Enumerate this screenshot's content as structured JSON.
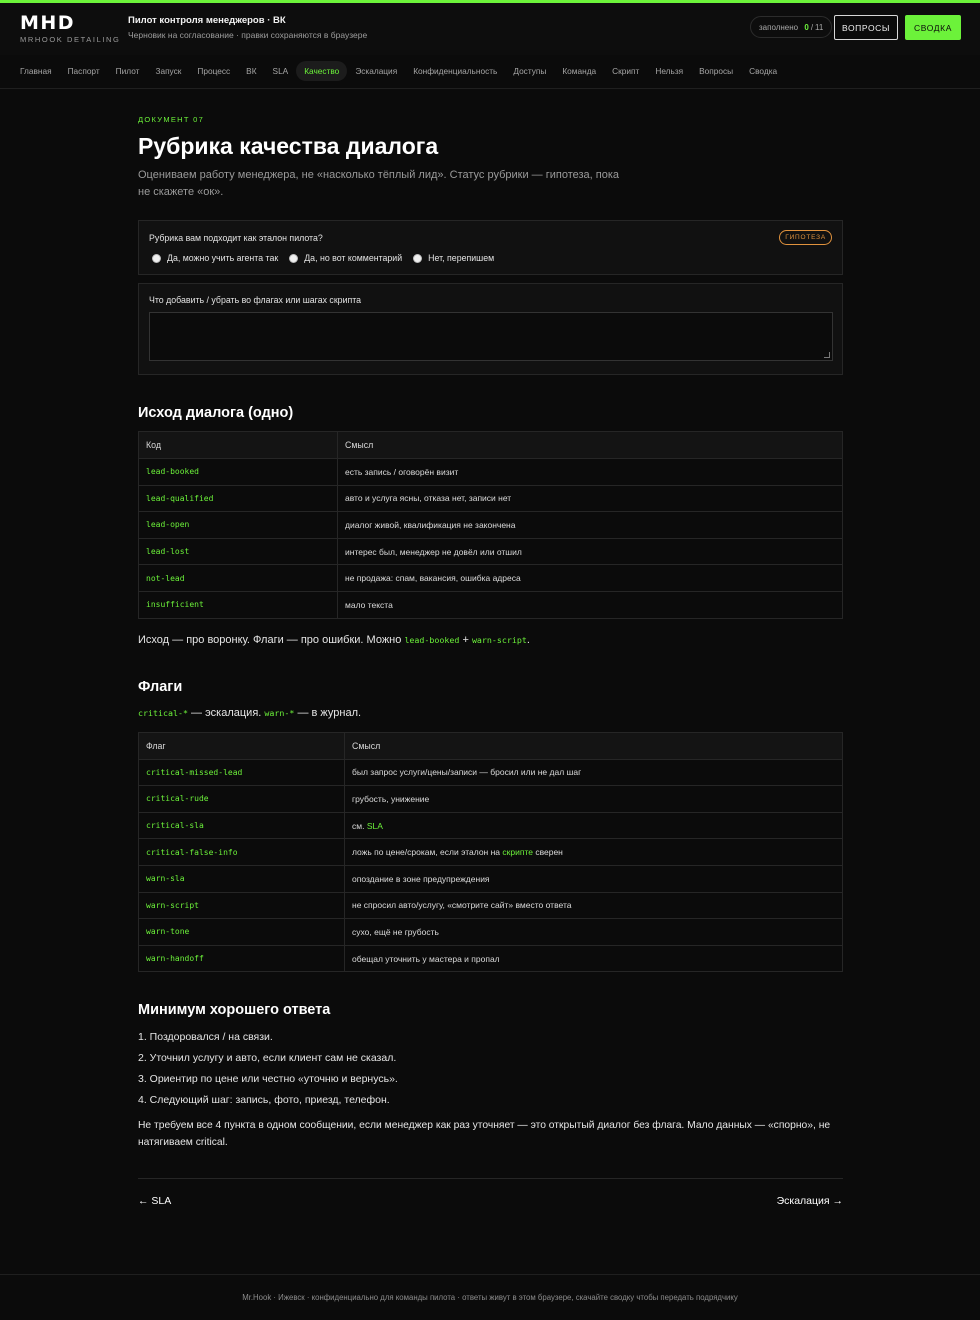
{
  "brand": {
    "mark": "MHD",
    "sub": "MRHOOK DETAILING"
  },
  "header": {
    "title": "Пилот контроля менеджеров · ВК",
    "subtitle": "Черновик на согласование · правки сохраняются в браузере",
    "progress": {
      "label": "заполнено",
      "filled": "0",
      "sep": "/",
      "total": "11"
    },
    "questions_label": "ВОПРОСЫ",
    "summary_label": "СВОДКА"
  },
  "nav": {
    "tabs": [
      "Главная",
      "Паспорт",
      "Пилот",
      "Запуск",
      "Процесс",
      "ВК",
      "SLA",
      "Качество",
      "Эскалация",
      "Конфиденциальность",
      "Доступы",
      "Команда",
      "Скрипт",
      "Нельзя",
      "Вопросы",
      "Сводка"
    ],
    "active_index": 7
  },
  "doc": {
    "label": "ДОКУМЕНТ 07",
    "title": "Рубрика качества диалога",
    "lead": "Оцениваем работу менеджера, не «насколько тёплый лид». Статус рубрики — гипотеза, пока не скажете «ок»."
  },
  "feedback": {
    "question": "Рубрика вам подходит как эталон пилота?",
    "badge": "ГИПОТЕЗА",
    "options": [
      "Да, можно учить агента так",
      "Да, но вот комментарий",
      "Нет, перепишем"
    ],
    "comment_label": "Что добавить / убрать во флагах или шагах скрипта",
    "comment_value": ""
  },
  "outcome": {
    "heading": "Исход диалога (одно)",
    "columns": [
      "Код",
      "Смысл"
    ],
    "rows": [
      [
        "lead-booked",
        "есть запись / оговорён визит"
      ],
      [
        "lead-qualified",
        "авто и услуга ясны, отказа нет, записи нет"
      ],
      [
        "lead-open",
        "диалог живой, квалификация не закончена"
      ],
      [
        "lead-lost",
        "интерес был, менеджер не довёл или отшил"
      ],
      [
        "not-lead",
        "не продажа: спам, вакансия, ошибка адреса"
      ],
      [
        "insufficient",
        "мало текста"
      ]
    ],
    "note": {
      "text": "Исход — про воронку. Флаги — про ошибки. Можно ",
      "code1": "lead-booked",
      "plus": " + ",
      "code2": "warn-script",
      "end": "."
    }
  },
  "flags": {
    "heading": "Флаги",
    "intro": {
      "code1": "critical-*",
      "mid": " — эскалация. ",
      "code2": "warn-*",
      "end": " — в журнал."
    },
    "columns": [
      "Флаг",
      "Смысл"
    ],
    "rows": [
      {
        "code": "critical-missed-lead",
        "text": "был запрос услуги/цены/записи — бросил или не дал шаг"
      },
      {
        "code": "critical-rude",
        "text": "грубость, унижение"
      },
      {
        "code": "critical-sla",
        "pre": "см. ",
        "link": "SLA",
        "post": ""
      },
      {
        "code": "critical-false-info",
        "pre": "ложь по цене/срокам, если эталон на ",
        "link": "скрипте",
        "post": " сверен"
      },
      {
        "code": "warn-sla",
        "text": "опоздание в зоне предупреждения"
      },
      {
        "code": "warn-script",
        "text": "не спросил авто/услугу, «смотрите сайт» вместо ответа"
      },
      {
        "code": "warn-tone",
        "text": "сухо, ещё не грубость"
      },
      {
        "code": "warn-handoff",
        "text": "обещал уточнить у мастера и пропал"
      }
    ]
  },
  "minimum": {
    "heading": "Минимум хорошего ответа",
    "items": [
      "1. Поздоровался / на связи.",
      "2. Уточнил услугу и авто, если клиент сам не сказал.",
      "3. Ориентир по цене или честно «уточню и вернусь».",
      "4. Следующий шаг: запись, фото, приезд, телефон."
    ],
    "note": "Не требуем все 4 пункта в одном сообщении, если менеджер как раз уточняет — это открытый диалог без флага. Мало данных — «спорно», не натягиваем critical."
  },
  "pager": {
    "prev": "← SLA",
    "next": "Эскалация →"
  },
  "footer": "Mr.Hook · Ижевск · конфиденциально для команды пилота · ответы живут в этом браузере, скачайте сводку чтобы передать подрядчику"
}
